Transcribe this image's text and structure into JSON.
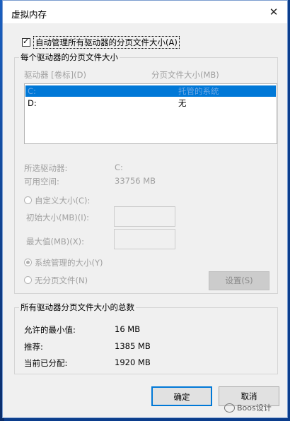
{
  "window": {
    "title": "虚拟内存",
    "close": "✕"
  },
  "auto_manage": {
    "label": "自动管理所有驱动器的分页文件大小(A)",
    "checked": true
  },
  "drives_group": {
    "title": "每个驱动器的分页文件大小",
    "col_drive": "驱动器 [卷标](D)",
    "col_size": "分页文件大小(MB)",
    "rows": [
      {
        "drive": "C:",
        "size": "托管的系统"
      },
      {
        "drive": "D:",
        "size": "无"
      }
    ],
    "selected_drive_label": "所选驱动器:",
    "selected_drive_value": "C:",
    "free_space_label": "可用空间:",
    "free_space_value": "33756 MB",
    "custom_size_label": "自定义大小(C):",
    "initial_size_label": "初始大小(MB)(I):",
    "max_size_label": "最大值(MB)(X):",
    "system_managed_label": "系统管理的大小(Y)",
    "no_paging_label": "无分页文件(N)",
    "set_button": "设置(S)"
  },
  "totals_group": {
    "title": "所有驱动器分页文件大小的总数",
    "min_label": "允许的最小值:",
    "min_value": "16 MB",
    "recommended_label": "推荐:",
    "recommended_value": "1385 MB",
    "current_label": "当前已分配:",
    "current_value": "1920 MB"
  },
  "buttons": {
    "ok": "确定",
    "cancel": "取消"
  },
  "watermark": {
    "text": "Boos设计"
  }
}
